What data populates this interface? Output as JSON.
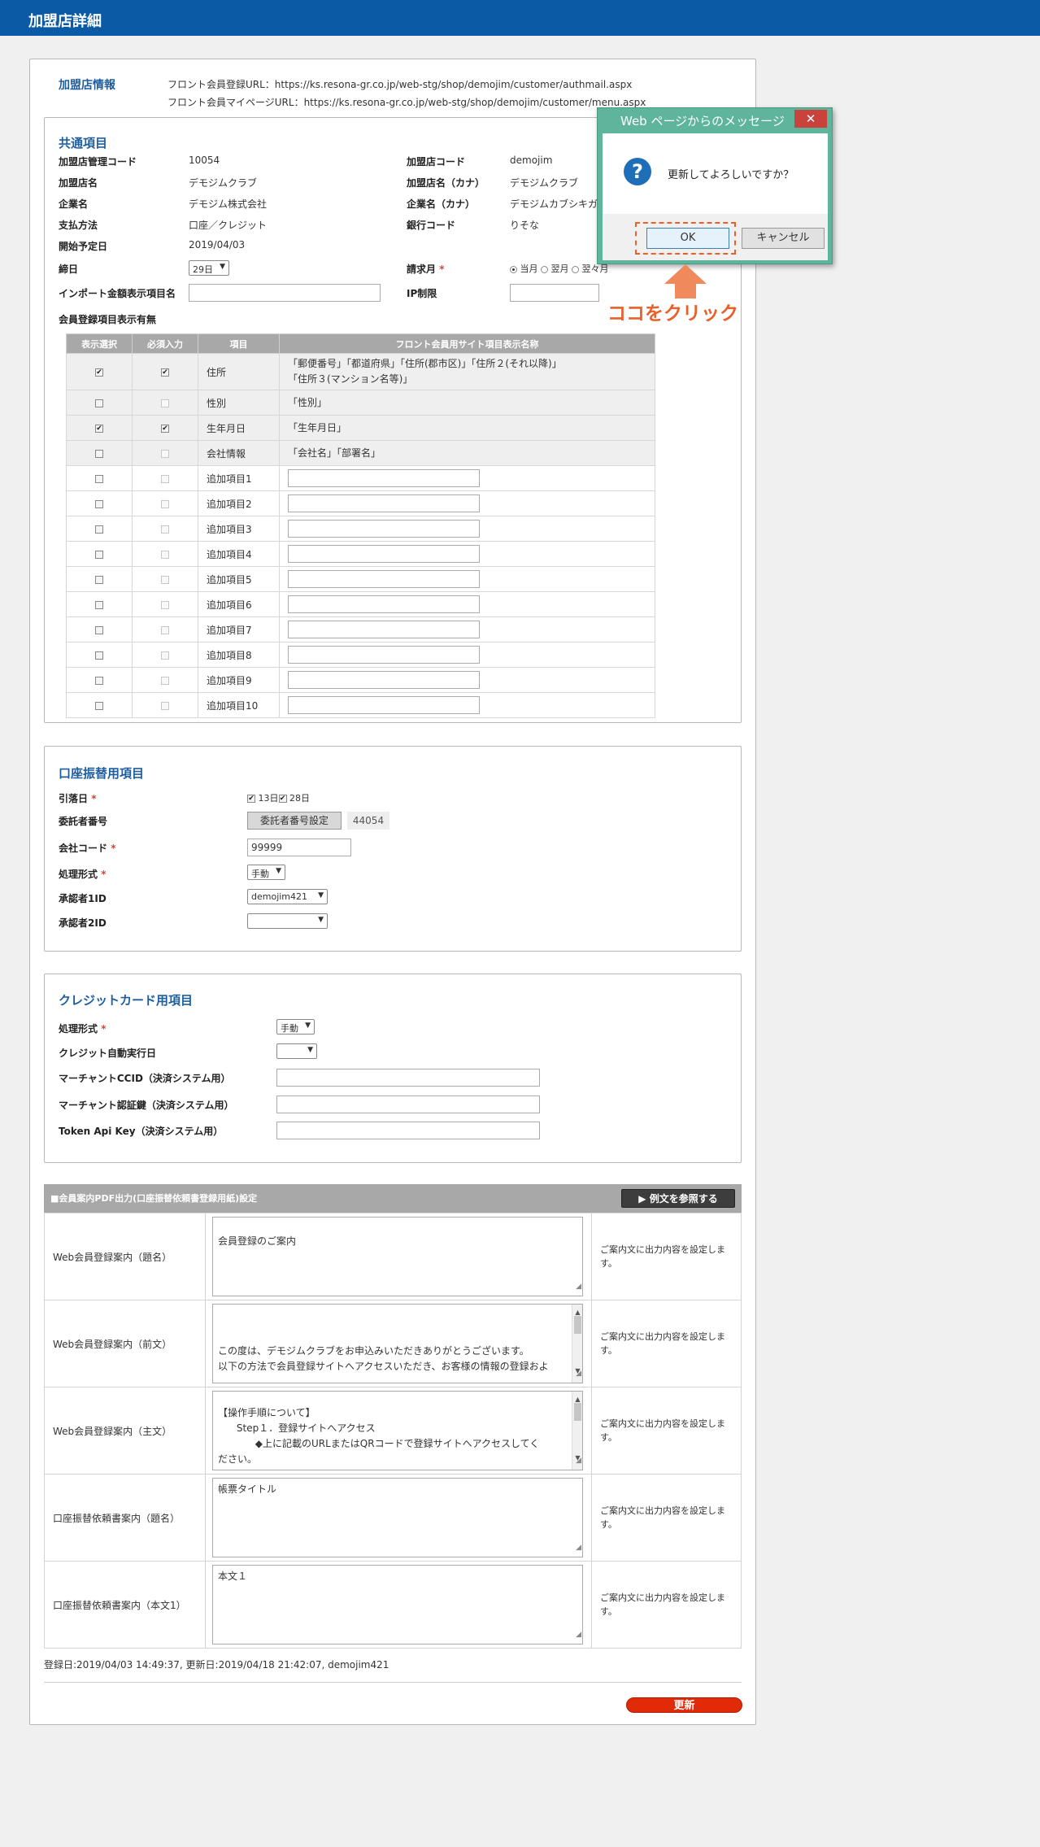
{
  "header": {
    "title": "加盟店詳細"
  },
  "info": {
    "title": "加盟店情報",
    "front_url": "フロント会員登録URL：https://ks.resona-gr.co.jp/web-stg/shop/demojim/customer/authmail.aspx",
    "mypage_url": "フロント会員マイページURL：https://ks.resona-gr.co.jp/web-stg/shop/demojim/customer/menu.aspx"
  },
  "common": {
    "title": "共通項目",
    "mgmt_code_label": "加盟店管理コード",
    "mgmt_code": "10054",
    "shop_code_label": "加盟店コード",
    "shop_code": "demojim",
    "shop_name_label": "加盟店名",
    "shop_name": "デモジムクラブ",
    "shop_kana_label": "加盟店名（カナ）",
    "shop_kana": "デモジムクラブ",
    "company_label": "企業名",
    "company": "デモジム株式会社",
    "company_kana_label": "企業名（カナ）",
    "company_kana": "デモジムカブシキガ",
    "payment_label": "支払方法",
    "payment": "口座／クレジット",
    "bank_label": "銀行コード",
    "bank": "りそな",
    "start_label": "開始予定日",
    "start": "2019/04/03",
    "closing_label": "締日",
    "closing": "29日",
    "billing_label": "請求月",
    "billing_options": [
      "当月",
      "翌月",
      "翌々月"
    ],
    "import_label": "インポート金額表示項目名",
    "ip_label": "IP制限",
    "reg_items_label": "会員登録項目表示有無",
    "table_headers": [
      "表示選択",
      "必須入力",
      "項目",
      "フロント会員用サイト項目表示名称"
    ],
    "rows": [
      {
        "item": "住所",
        "display": true,
        "required": true,
        "front": "「郵便番号」「都道府県」「住所(郡市区)」「住所２(それ以降)」",
        "front2": "「住所３(マンション名等)」"
      },
      {
        "item": "性別",
        "display": false,
        "required": false,
        "front": "「性別」",
        "front2": ""
      },
      {
        "item": "生年月日",
        "display": true,
        "required": true,
        "front": "「生年月日」",
        "front2": ""
      },
      {
        "item": "会社情報",
        "display": false,
        "required": false,
        "front": "「会社名」「部署名」",
        "front2": ""
      }
    ],
    "extra_rows": [
      "追加項目1",
      "追加項目2",
      "追加項目3",
      "追加項目4",
      "追加項目5",
      "追加項目6",
      "追加項目7",
      "追加項目8",
      "追加項目9",
      "追加項目10"
    ]
  },
  "account": {
    "title": "口座振替用項目",
    "withdraw_label": "引落日",
    "withdraw_opts": [
      "13日",
      "28日"
    ],
    "consignor_label": "委託者番号",
    "consignor_btn": "委託者番号設定",
    "consignor": "44054",
    "company_code_label": "会社コード",
    "company_code": "99999",
    "process_label": "処理形式",
    "process": "手動",
    "approver1_label": "承認者1ID",
    "approver1": "demojim421",
    "approver2_label": "承認者2ID",
    "approver2": ""
  },
  "credit": {
    "title": "クレジットカード用項目",
    "process_label": "処理形式",
    "process": "手動",
    "auto_label": "クレジット自動実行日",
    "auto": "",
    "ccid_label": "マーチャントCCID（決済システム用）",
    "auth_label": "マーチャント認証鍵（決済システム用）",
    "token_label": "Token Api Key（決済システム用）"
  },
  "pdf": {
    "title": "■会員案内PDF出力(口座振替依頼書登録用紙)設定",
    "example_btn": "▶ 例文を参照する",
    "hint": "ご案内文に出力内容を設定します。",
    "rows": [
      {
        "label": "Web会員登録案内（題名）",
        "text": "会員登録のご案内"
      },
      {
        "label": "Web会員登録案内（前文）",
        "text": "\nこの度は、デモジムクラブをお申込みいただきありがとうございます。\n以下の方法で会員登録サイトへアクセスいただき、お客様の情報の登録およ"
      },
      {
        "label": "Web会員登録案内（主文）",
        "text": "【操作手順について】\n      Step１．登録サイトへアクセス\n            ◆上に記載のURLまたはQRコードで登録サイトへアクセスしてく\nださい。"
      },
      {
        "label": "口座振替依頼書案内（題名）",
        "text": "帳票タイトル"
      },
      {
        "label": "口座振替依頼書案内（本文1）",
        "text": "本文１"
      }
    ]
  },
  "footer": {
    "meta": "登録日:2019/04/03 14:49:37, 更新日:2019/04/18 21:42:07, demojim421",
    "update_btn": "更新"
  },
  "dialog": {
    "title": "Web ページからのメッセージ",
    "close": "✕",
    "message": "更新してよろしいですか？",
    "ok": "OK",
    "cancel": "キャンセル",
    "annotation": "ココをクリック"
  }
}
